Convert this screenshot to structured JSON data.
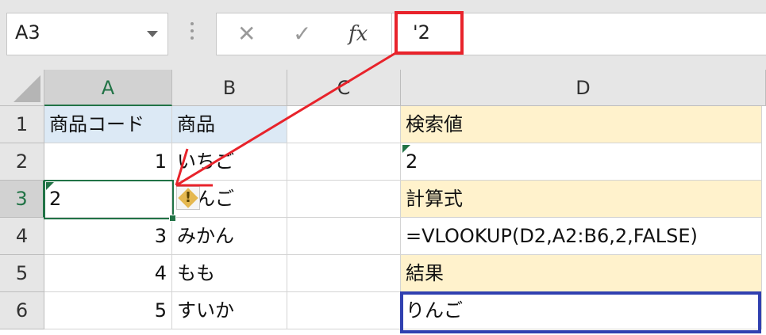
{
  "formula_bar": {
    "name_box": "A3",
    "cancel_glyph": "✕",
    "enter_glyph": "✓",
    "fx_label": "fx",
    "formula": "'2"
  },
  "columns": [
    "A",
    "B",
    "C",
    "D"
  ],
  "rows": [
    "1",
    "2",
    "3",
    "4",
    "5",
    "6"
  ],
  "cells": {
    "A1": "商品コード",
    "B1": "商品",
    "A2": "1",
    "B2": "いちご",
    "A3": "2",
    "B3": "りんご",
    "A4": "3",
    "B4": "みかん",
    "A5": "4",
    "B5": "もも",
    "A6": "5",
    "B6": "すいか",
    "D1": "検索値",
    "D2": "2",
    "D3": "計算式",
    "D4": "=VLOOKUP(D2,A2:B6,2,FALSE)",
    "D5": "結果",
    "D6": "りんご"
  },
  "error_indicator": "!",
  "colors": {
    "selection_green": "#217346",
    "header_blue": "#dce9f5",
    "label_yellow": "#fff2cc",
    "highlight_red": "#e8232b",
    "highlight_blue": "#3040b0"
  }
}
